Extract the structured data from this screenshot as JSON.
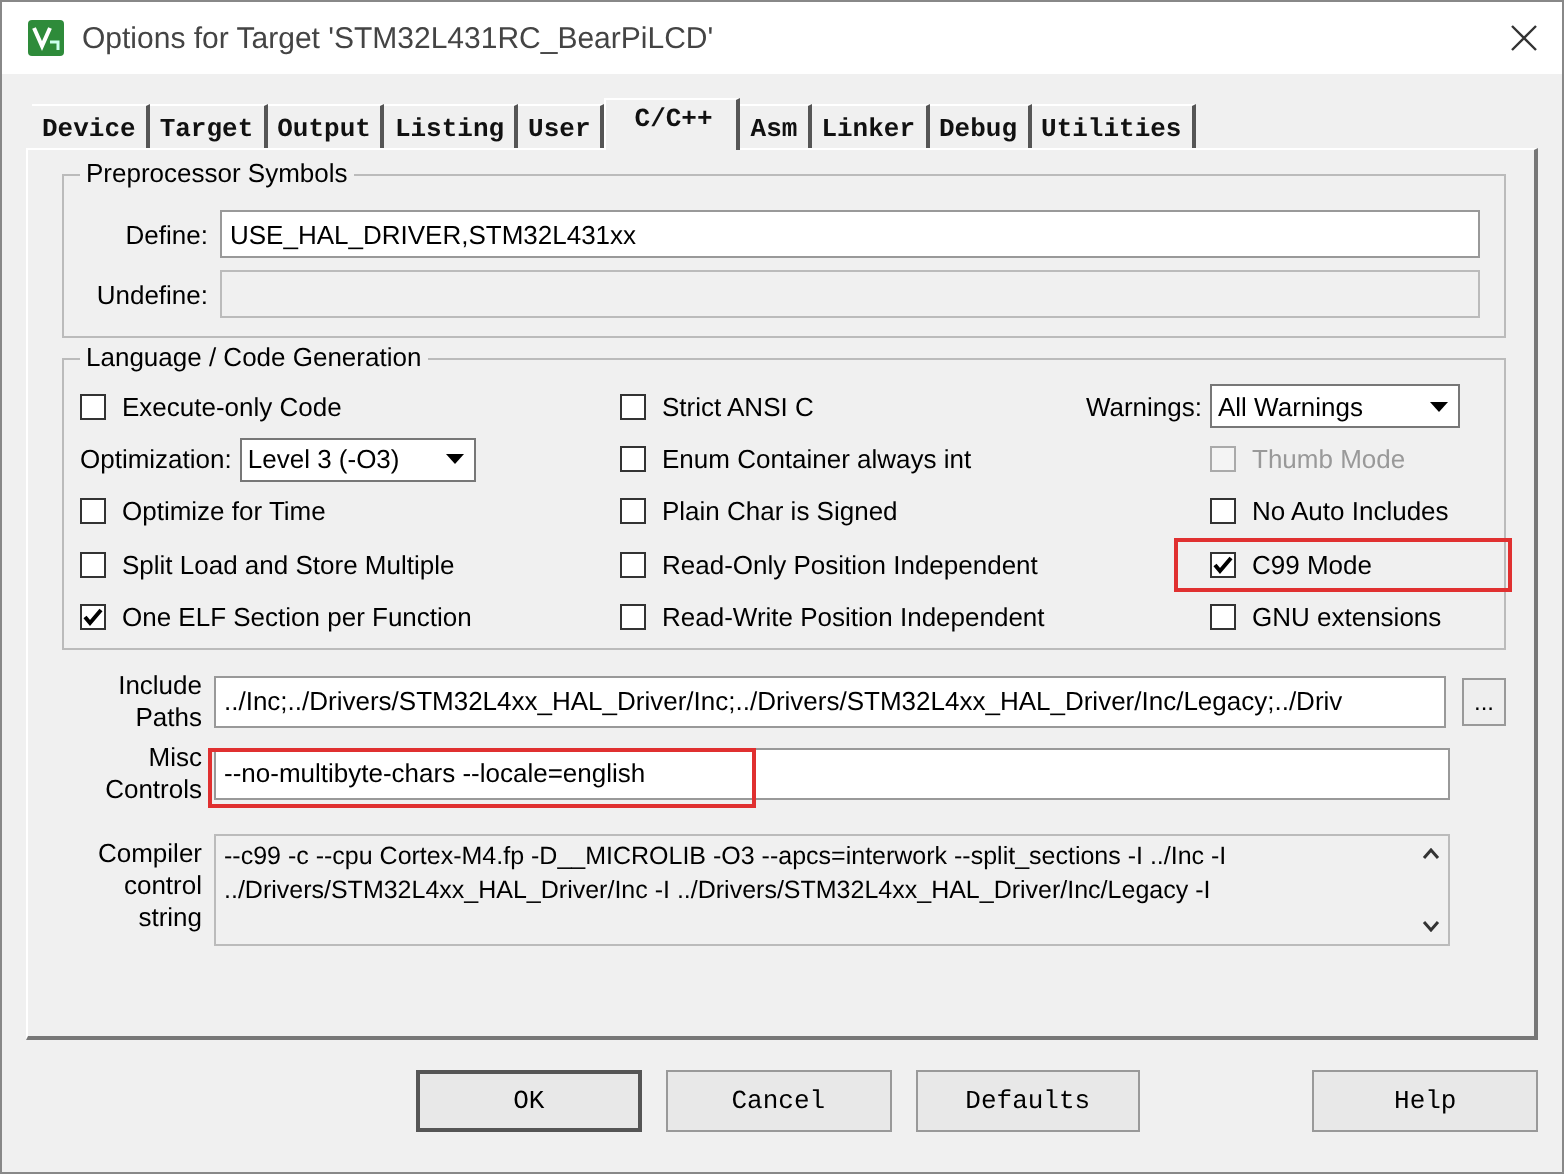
{
  "window": {
    "title": "Options for Target 'STM32L431RC_BearPiLCD'"
  },
  "tabs": [
    {
      "label": "Device",
      "selected": false
    },
    {
      "label": "Target",
      "selected": false
    },
    {
      "label": "Output",
      "selected": false
    },
    {
      "label": "Listing",
      "selected": false
    },
    {
      "label": "User",
      "selected": false
    },
    {
      "label": "C/C++",
      "selected": true
    },
    {
      "label": "Asm",
      "selected": false
    },
    {
      "label": "Linker",
      "selected": false
    },
    {
      "label": "Debug",
      "selected": false
    },
    {
      "label": "Utilities",
      "selected": false
    }
  ],
  "preprocessor": {
    "title": "Preprocessor Symbols",
    "define": {
      "label": "Define:",
      "value": "USE_HAL_DRIVER,STM32L431xx"
    },
    "undefine": {
      "label": "Undefine:",
      "disabled": true
    }
  },
  "code_generation": {
    "title": "Language / Code Generation",
    "columns": [
      [
        {
          "kind": "checkbox",
          "label": "Execute-only Code",
          "checked": false,
          "disabled": false,
          "highlighted": false
        },
        {
          "kind": "dropdown",
          "label": "Optimization:",
          "value": "Level 3 (-O3)"
        },
        {
          "kind": "checkbox",
          "label": "Optimize for Time",
          "checked": false,
          "disabled": false,
          "highlighted": false
        },
        {
          "kind": "checkbox",
          "label": "Split Load and Store Multiple",
          "checked": false,
          "disabled": false,
          "highlighted": false
        },
        {
          "kind": "checkbox",
          "label": "One ELF Section per Function",
          "checked": true,
          "disabled": false,
          "highlighted": false
        }
      ],
      [
        {
          "kind": "checkbox",
          "label": "Strict ANSI C",
          "checked": false,
          "disabled": false,
          "highlighted": false
        },
        {
          "kind": "checkbox",
          "label": "Enum Container always int",
          "checked": false,
          "disabled": false,
          "highlighted": false
        },
        {
          "kind": "checkbox",
          "label": "Plain Char is Signed",
          "checked": false,
          "disabled": false,
          "highlighted": false
        },
        {
          "kind": "checkbox",
          "label": "Read-Only Position Independent",
          "checked": false,
          "disabled": false,
          "highlighted": false
        },
        {
          "kind": "checkbox",
          "label": "Read-Write Position Independent",
          "checked": false,
          "disabled": false,
          "highlighted": false
        }
      ],
      [
        {
          "kind": "dropdown",
          "label": "Warnings:",
          "value": "All Warnings"
        },
        {
          "kind": "checkbox",
          "label": "Thumb Mode",
          "checked": false,
          "disabled": true,
          "highlighted": false
        },
        {
          "kind": "checkbox",
          "label": "No Auto Includes",
          "checked": false,
          "disabled": false,
          "highlighted": false
        },
        {
          "kind": "checkbox",
          "label": "C99 Mode",
          "checked": true,
          "disabled": false,
          "highlighted": true
        },
        {
          "kind": "checkbox",
          "label": "GNU extensions",
          "checked": false,
          "disabled": false,
          "highlighted": false
        }
      ]
    ]
  },
  "include_paths": {
    "label": [
      "Include",
      "Paths"
    ],
    "value": "../Inc;../Drivers/STM32L4xx_HAL_Driver/Inc;../Drivers/STM32L4xx_HAL_Driver/Inc/Legacy;../Driv",
    "browse": "..."
  },
  "misc_controls": {
    "label": [
      "Misc",
      "Controls"
    ],
    "value": "--no-multibyte-chars --locale=english",
    "highlighted": true
  },
  "compiler_string": {
    "label": [
      "Compiler",
      "control",
      "string"
    ],
    "lines": [
      "--c99 -c --cpu Cortex-M4.fp -D__MICROLIB -O3 --apcs=interwork --split_sections -I ../Inc -I",
      "../Drivers/STM32L4xx_HAL_Driver/Inc -I ../Drivers/STM32L4xx_HAL_Driver/Inc/Legacy -I"
    ]
  },
  "buttons": [
    {
      "label": "OK",
      "kind": "primary"
    },
    {
      "label": "Cancel",
      "kind": "normal"
    },
    {
      "label": "Defaults",
      "kind": "normal"
    },
    {
      "label": "Help",
      "kind": "help"
    }
  ]
}
